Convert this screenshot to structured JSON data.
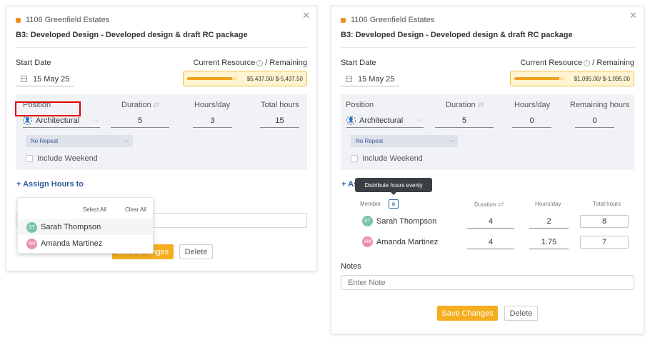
{
  "left": {
    "project": "1106 Greenfield Estates",
    "task": "B3: Developed Design - Developed design & draft RC package",
    "start_date_label": "Start Date",
    "start_date": "15 May 25",
    "resource_label": "Current Resource",
    "remaining_label": "/ Remaining",
    "resource_values": "$5,437.50/ $-5,437.50",
    "resource_fill_pct": 90,
    "position_label": "Position",
    "position_value": "Architectural",
    "duration_label": "Duration",
    "duration": "5",
    "hours_label": "Hours/day",
    "hours": "3",
    "total_label": "Total hours",
    "total": "15",
    "repeat": "No Repeat",
    "weekend": "Include Weekend",
    "assign": "+ Assign Hours to",
    "select_all": "Select All",
    "clear_all": "Clear All",
    "members": [
      {
        "initials": "ST",
        "name": "Sarah Thompson"
      },
      {
        "initials": "AM",
        "name": "Amanda Martinez"
      }
    ],
    "save": "Save Changes",
    "delete": "Delete"
  },
  "right": {
    "project": "1106 Greenfield Estates",
    "task": "B3: Developed Design - Developed design & draft RC package",
    "start_date_label": "Start Date",
    "start_date": "15 May 25",
    "resource_label": "Current Resource",
    "remaining_label": "/ Remaining",
    "resource_values": "$1,095.00/ $-1,095.00",
    "resource_fill_pct": 90,
    "position_label": "Position",
    "position_value": "Architectural",
    "duration_label": "Duration",
    "duration": "5",
    "hours_label": "Hours/day",
    "hours": "0",
    "remaining_hours_label": "Remaining hours",
    "remaining_hours": "0",
    "repeat": "No Repeat",
    "weekend": "Include Weekend",
    "assign": "+ Ass",
    "tooltip": "Distribute hours evenly",
    "member_header": "Member",
    "m_duration_header": "Duration",
    "m_hours_header": "Hours/day",
    "m_total_header": "Total hours",
    "members": [
      {
        "initials": "ST",
        "name": "Sarah Thompson",
        "duration": "4",
        "hours": "2",
        "total": "8"
      },
      {
        "initials": "AM",
        "name": "Amanda Martinez",
        "duration": "4",
        "hours": "1.75",
        "total": "7"
      }
    ],
    "notes_label": "Notes",
    "notes_placeholder": "Enter Note",
    "save": "Save Changes",
    "delete": "Delete"
  },
  "colors": {
    "accent": "#f5ae20",
    "link": "#2d5c9b",
    "highlight_box": "#e00000"
  }
}
